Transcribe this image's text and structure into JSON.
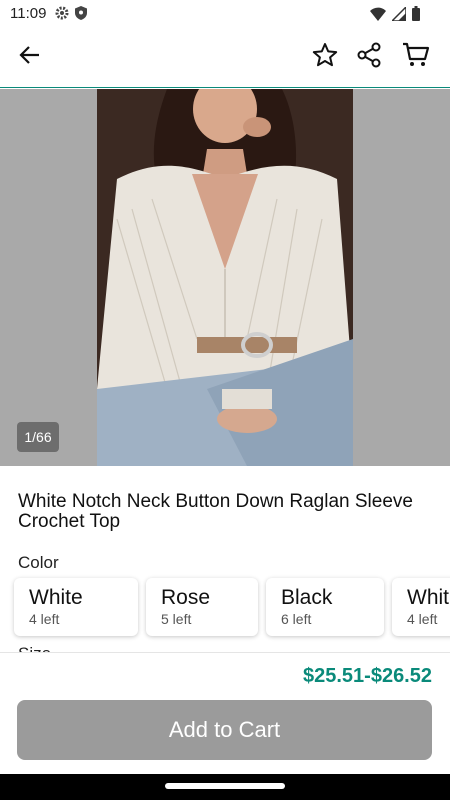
{
  "status": {
    "time": "11:09"
  },
  "header": {
    "back_icon": "arrow-left-icon",
    "favorite_icon": "star-outline-icon",
    "share_icon": "share-icon",
    "cart_icon": "cart-icon"
  },
  "gallery": {
    "counter": "1/66"
  },
  "product": {
    "title": "White Notch Neck Button Down Raglan Sleeve Crochet Top",
    "color_label": "Color",
    "colors": [
      {
        "name": "White",
        "stock": "4 left"
      },
      {
        "name": "Rose",
        "stock": "5 left"
      },
      {
        "name": "Black",
        "stock": "6 left"
      },
      {
        "name": "Whit",
        "stock": "4 left"
      }
    ],
    "size_label": "Size"
  },
  "purchase": {
    "price": "$25.51-$26.52",
    "add_to_cart": "Add to Cart"
  },
  "colors": {
    "accent": "#0a8a7a",
    "button_disabled": "#9b9b9b"
  }
}
